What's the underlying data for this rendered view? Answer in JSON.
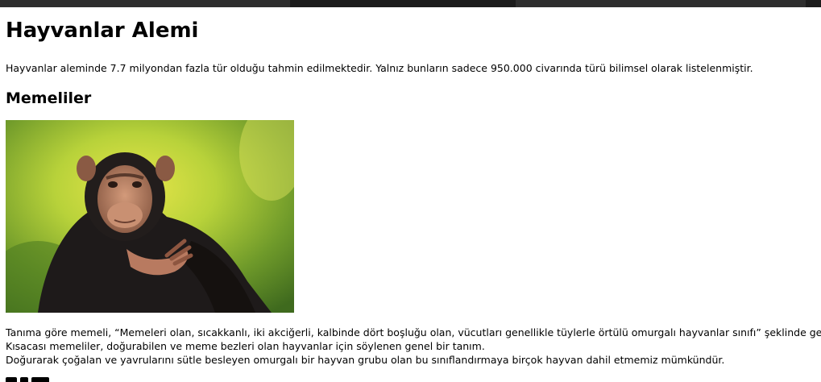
{
  "page": {
    "title": "Hayvanlar Alemi",
    "intro": "Hayvanlar aleminde 7.7 milyondan fazla tür olduğu tahmin edilmektedir. Yalnız bunların sadece 950.000 civarında türü bilimsel olarak listelenmiştir."
  },
  "section_mammals": {
    "heading": "Memeliler",
    "image_alt": "chimpanzee-photo",
    "lines": [
      "Tanıma göre memeli, “Memeleri olan, sıcakkanlı, iki akciğerli, kalbinde dört boşluğu olan, vücutları genellikle tüylerle örtülü omurgalı hayvanlar sınıfı” şeklinde geçiyor.",
      "Kısacası memeliler, doğurabilen ve meme bezleri olan hayvanlar için söylenen genel bir tanım.",
      "Doğurarak çoğalan ve yavrularını sütle besleyen omurgalı bir hayvan grubu olan bu sınıflandırmaya birçok hayvan dahil etmemiz mümkündür."
    ]
  },
  "colors": {
    "topbar": "#1c1c1c",
    "text": "#000000",
    "background": "#ffffff"
  }
}
